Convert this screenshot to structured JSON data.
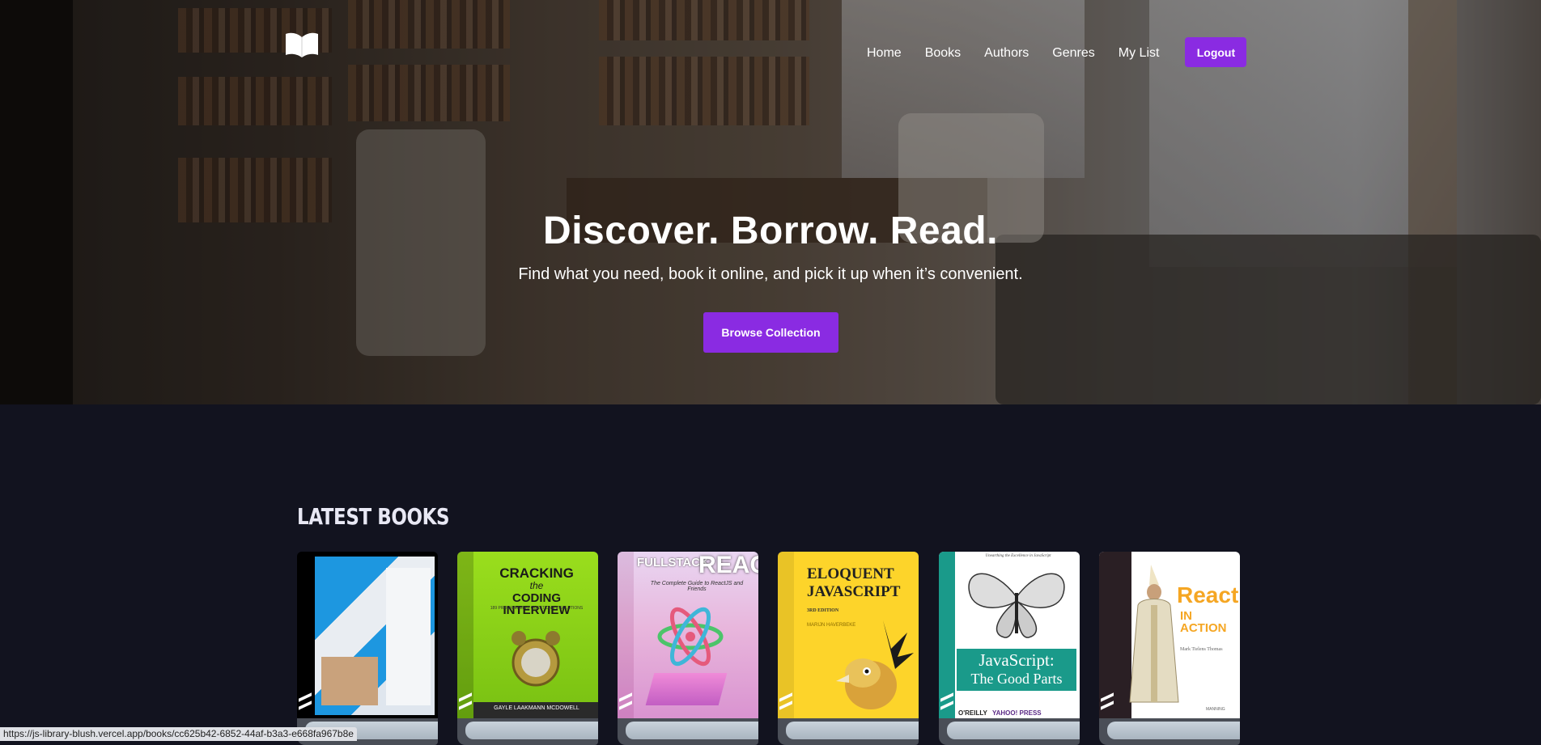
{
  "nav": {
    "logo_icon": "open-book-icon",
    "items": [
      "Home",
      "Books",
      "Authors",
      "Genres",
      "My List"
    ],
    "logout_label": "Logout"
  },
  "hero": {
    "title": "Discover. Borrow. Read.",
    "subtitle": "Find what you need, book it online, and pick it up when it’s convenient.",
    "cta_label": "Browse Collection"
  },
  "latest": {
    "heading": "LATEST BOOKS",
    "books": [
      {
        "cover_color": "#000000",
        "cover_text": ""
      },
      {
        "cover_color": "#8cd11a",
        "cover_text": "CRACKING the CODING INTERVIEW",
        "line1": "CRACKING",
        "line2": "the",
        "line3": "CODING INTERVIEW",
        "line4": "189 PROGRAMMING QUESTIONS & SOLUTIONS",
        "author": "GAYLE LAAKMANN MCDOWELL"
      },
      {
        "cover_color": "#e7b9d8",
        "cover_text": "FULLSTACK REACT",
        "line1": "FULLSTACK",
        "line2": "REACT",
        "line3": "The Complete Guide to ReactJS and Friends"
      },
      {
        "cover_color": "#fdd42a",
        "cover_text": "ELOQUENT JAVASCRIPT",
        "line1": "ELOQUENT",
        "line2": "JAVASCRIPT",
        "line3": "3RD EDITION",
        "author": "MARIJN HAVERBEKE"
      },
      {
        "cover_color": "#ffffff",
        "cover_text": "JavaScript: The Good Parts",
        "line1": "Unearthing the Excellence in JavaScript",
        "line2": "JavaScript:",
        "line3": "The Good Parts",
        "publisher": "O'REILLY",
        "partner": "YAHOO! PRESS"
      },
      {
        "cover_color": "#ffffff",
        "cover_text": "React IN ACTION",
        "line1": "React",
        "line2": "IN ACTION",
        "author": "Mark Tielens Thomas",
        "publisher": "MANNING"
      }
    ]
  },
  "status_url": "https://js-library-blush.vercel.app/books/cc625b42-6852-44af-b3a3-e668fa967b8e"
}
